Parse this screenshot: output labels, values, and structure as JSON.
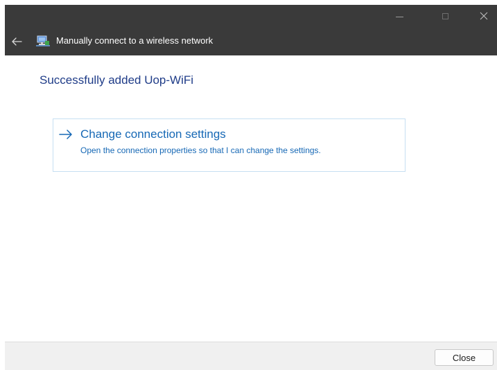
{
  "window": {
    "title": "Manually connect to a wireless network"
  },
  "content": {
    "heading": "Successfully added Uop-WiFi",
    "option": {
      "title": "Change connection settings",
      "description": "Open the connection properties so that I can change the settings."
    }
  },
  "footer": {
    "close_label": "Close"
  },
  "icons": {
    "back": "arrow-left-icon",
    "network": "network-computer-icon",
    "option_arrow": "arrow-right-icon",
    "minimize": "minimize-icon",
    "maximize": "maximize-icon",
    "close": "close-icon"
  },
  "colors": {
    "titlebar": "#3a3a3a",
    "heading": "#1f3c88",
    "link": "#1668b5",
    "option_border": "#c6dff2",
    "footer": "#f0f0f0"
  }
}
